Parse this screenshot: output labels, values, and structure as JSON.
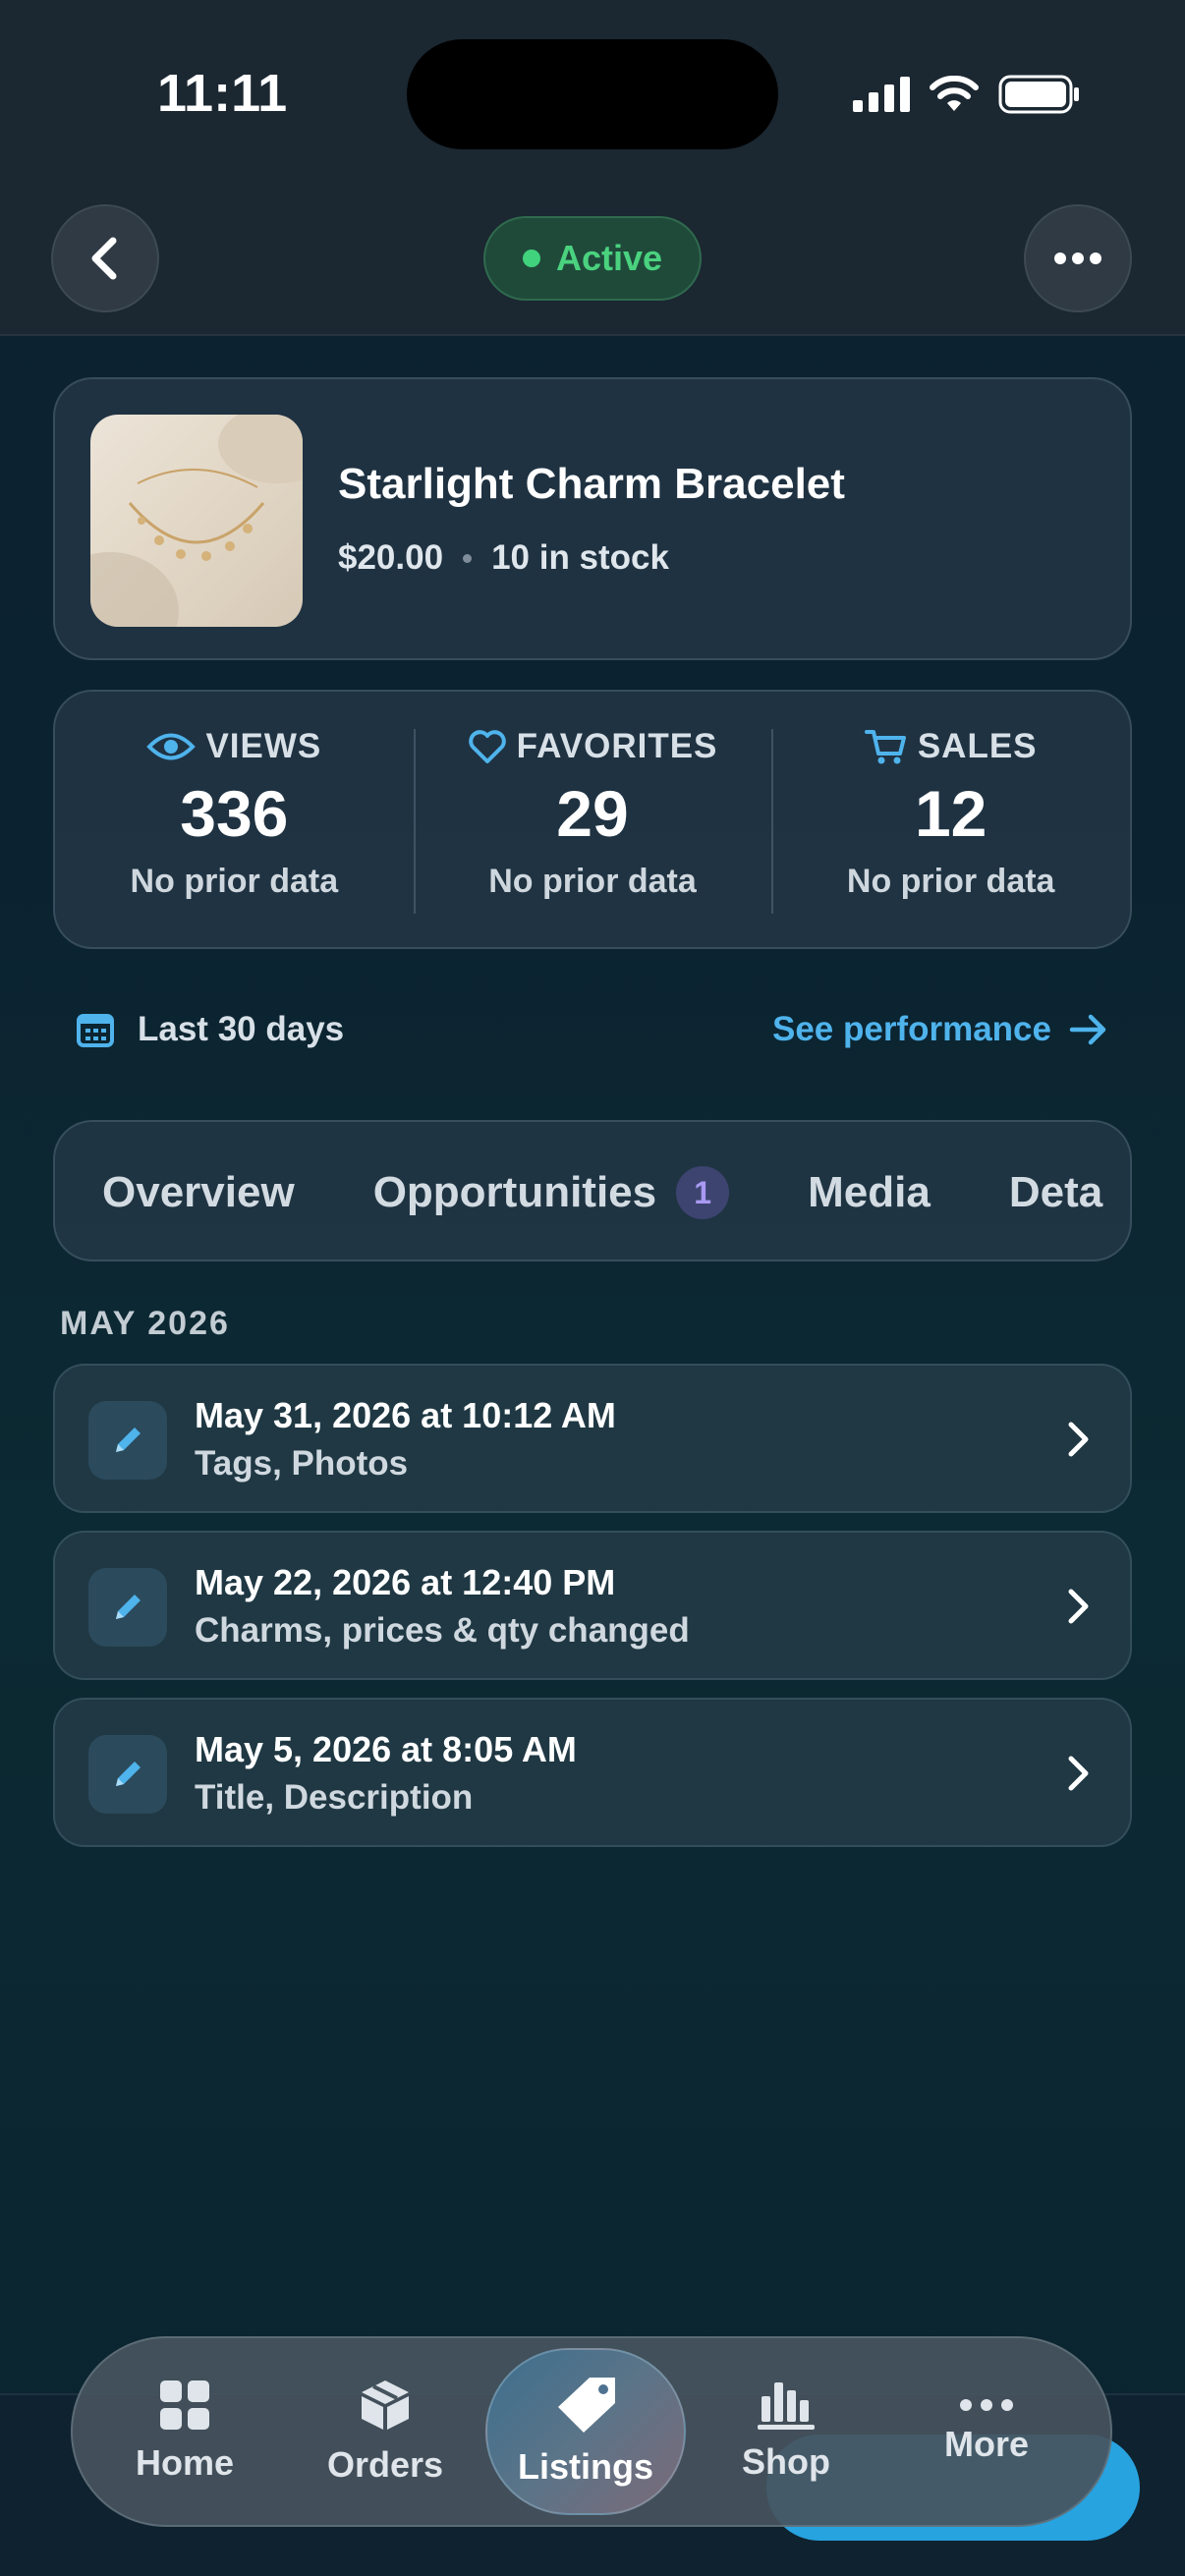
{
  "status_bar": {
    "time": "11:11"
  },
  "header": {
    "status_label": "Active",
    "colors": {
      "active_bg": "#1f4a3a",
      "active_text": "#4ad27f"
    }
  },
  "product": {
    "title": "Starlight Charm Bracelet",
    "price": "$20.00",
    "stock": "10 in stock"
  },
  "stats": [
    {
      "label": "VIEWS",
      "icon": "eye-icon",
      "value": "336",
      "sub": "No prior data"
    },
    {
      "label": "FAVORITES",
      "icon": "heart-icon",
      "value": "29",
      "sub": "No prior data"
    },
    {
      "label": "SALES",
      "icon": "cart-icon",
      "value": "12",
      "sub": "No prior data"
    }
  ],
  "range": {
    "label": "Last 30 days",
    "link": "See performance"
  },
  "tabs": [
    {
      "label": "Overview"
    },
    {
      "label": "Opportunities",
      "badge": "1"
    },
    {
      "label": "Media"
    },
    {
      "label": "Deta"
    }
  ],
  "history": {
    "section": "MAY 2026",
    "items": [
      {
        "title": "May 31, 2026 at 10:12 AM",
        "sub": "Tags, Photos"
      },
      {
        "title": "May 22, 2026 at 12:40 PM",
        "sub": "Charms, prices & qty changed"
      },
      {
        "title": "May 5, 2026 at 8:05 AM",
        "sub": "Title, Description"
      }
    ]
  },
  "tabbar": [
    {
      "label": "Home",
      "icon": "grid-icon"
    },
    {
      "label": "Orders",
      "icon": "box-icon"
    },
    {
      "label": "Listings",
      "icon": "tag-icon",
      "active": true
    },
    {
      "label": "Shop",
      "icon": "bar-chart-icon"
    },
    {
      "label": "More",
      "icon": "dots-icon"
    }
  ],
  "accent": "#4fb3ec"
}
